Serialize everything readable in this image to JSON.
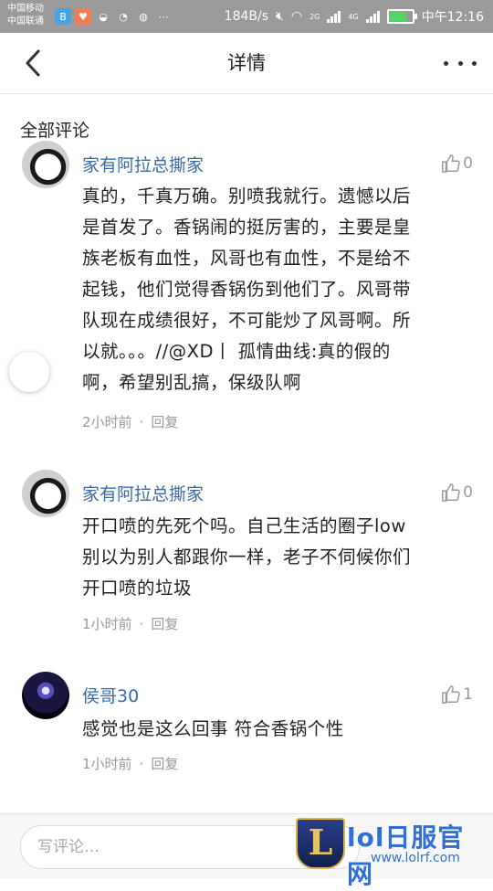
{
  "status_bar": {
    "carrier_1": "中国移动",
    "carrier_2": "中国联通",
    "speed": "184B/s",
    "network_1": "2G",
    "network_2": "4G",
    "time": "中午12:16"
  },
  "navbar": {
    "title": "详情"
  },
  "section": {
    "title": "全部评论"
  },
  "comments": [
    {
      "username": "家有阿拉总撕家",
      "likes": "0",
      "lines": [
        "真的，千真万确。别喷我就行。遗憾以后",
        "是首发了。香锅闹的挺厉害的，主要是皇",
        "族老板有血性，风哥也有血性，不是给不",
        "起钱，他们觉得香锅伤到他们了。风哥带",
        "队现在成绩很好，不可能炒了风哥啊。所",
        "以就。。。//@XD丨 孤情曲线:真的假的",
        "啊，希望别乱搞，保级队啊"
      ],
      "time": "2小时前",
      "reply": "回复"
    },
    {
      "username": "家有阿拉总撕家",
      "likes": "0",
      "lines": [
        "开口喷的先死个吗。自己生活的圈子low",
        "别以为别人都跟你一样，老子不伺候你们",
        "开口喷的垃圾"
      ],
      "time": "1小时前",
      "reply": "回复"
    },
    {
      "username": "侯哥30",
      "likes": "1",
      "lines": [
        "感觉也是这么回事 符合香锅个性"
      ],
      "time": "1小时前",
      "reply": "回复"
    }
  ],
  "input": {
    "placeholder": "写评论…"
  },
  "watermark": {
    "logo_letter": "L",
    "title": "lol日服官网",
    "url": "www.lolrf.com"
  },
  "colors": {
    "status_bar_bg": "#9a9a9a",
    "username": "#3b6aa8",
    "meta": "#9a9a9a",
    "watermark": "#2f6fd6"
  }
}
